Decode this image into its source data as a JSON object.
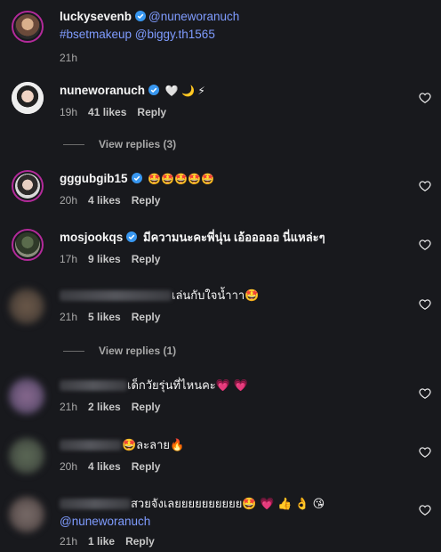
{
  "caption": {
    "username": "luckysevenb",
    "mention": "@nuneworanuch",
    "tags": "#bsetmakeup @biggy.th1565",
    "time": "21h"
  },
  "comments": [
    {
      "username": "nuneworanuch",
      "text": "🤍 🌙 ⚡",
      "time": "19h",
      "likes": "41 likes",
      "reply": "Reply",
      "view_replies": "View replies (3)"
    },
    {
      "username": "gggubgib15",
      "text": "🤩🤩🤩🤩🤩",
      "time": "20h",
      "likes": "4 likes",
      "reply": "Reply"
    },
    {
      "username": "mosjookqs",
      "text": "มีความนะคะพี่นุ่น เอ้อออออ นี่แหล่ะๆ",
      "time": "17h",
      "likes": "9 likes",
      "reply": "Reply"
    },
    {
      "username": "",
      "text": "เล่นกับใจน้ำาา🤩",
      "time": "21h",
      "likes": "5 likes",
      "reply": "Reply",
      "view_replies": "View replies (1)"
    },
    {
      "username": "",
      "text": "เด็กวัยรุ่นที่ไหนคะ💗 💗",
      "time": "21h",
      "likes": "2 likes",
      "reply": "Reply"
    },
    {
      "username": "",
      "text": "🤩ละลาย🔥",
      "time": "20h",
      "likes": "4 likes",
      "reply": "Reply"
    },
    {
      "username": "",
      "text": "สวยจังเลยยยยยยยยยย🤩 💗 👍 👌 😘",
      "mention": "@nuneworanuch",
      "time": "21h",
      "likes": "1 like",
      "reply": "Reply"
    }
  ],
  "colors": {
    "background": "#18191d",
    "link": "#7f9cff",
    "verified": "#3897f0",
    "story_ring": "#b32a9a"
  }
}
